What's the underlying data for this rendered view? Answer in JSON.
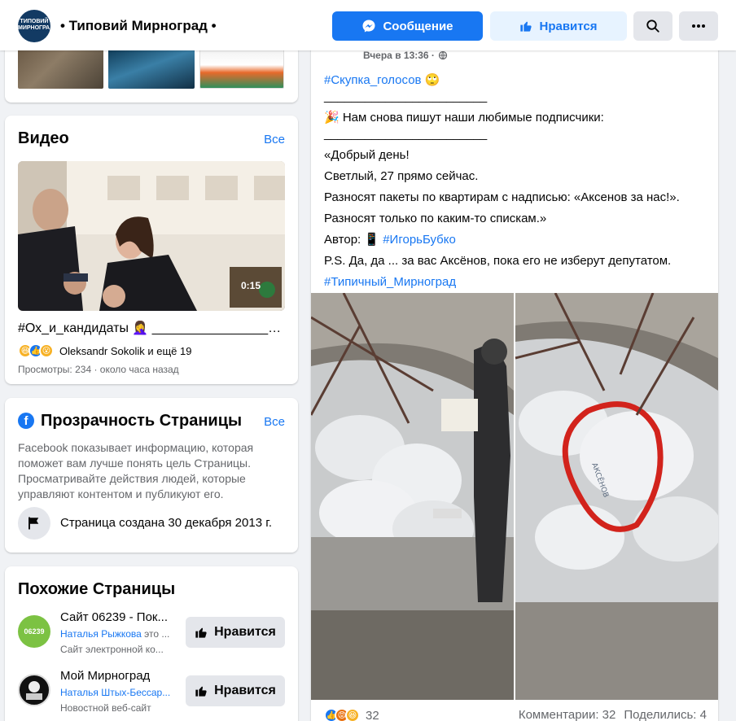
{
  "header": {
    "page_name": "• Типовий Мирноград •",
    "logo_text": "ТИПОВИЙ МИРНОГРАД",
    "message_label": "Сообщение",
    "like_label": "Нравится"
  },
  "video": {
    "title": "Видео",
    "see_all": "Все",
    "duration": "0:15",
    "caption": "#Ох_и_кандидаты 🤦‍♀️ ____________________...",
    "reactions_text": "Oleksandr Sokolik и ещё 19",
    "views": "Просмотры: 234 · около часа назад"
  },
  "transparency": {
    "title": "Прозрачность Страницы",
    "see_all": "Все",
    "description": "Facebook показывает информацию, которая поможет вам лучше понять цель Страницы. Просматривайте действия людей, которые управляют контентом и публикуют его.",
    "created": "Страница создана 30 декабря 2013 г."
  },
  "similar": {
    "title": "Похожие Страницы",
    "items": [
      {
        "name": "Сайт 06239 - Пок...",
        "person": "Наталья Рыжкова",
        "person_suffix": " это ...",
        "category": "Сайт электронной ко...",
        "button": "Нравится",
        "avatar_text": "06239"
      },
      {
        "name": "Мой Мирноград",
        "person": "Наталья Штых-Бессар...",
        "person_suffix": "",
        "category": "Новостной веб-сайт",
        "button": "Нравится",
        "avatar_text": ""
      }
    ]
  },
  "post": {
    "time": "Вчера в 13:36 ·",
    "hashtag_top": "#Скупка_голосов 🙄",
    "rule1": "________________________",
    "intro": "🎉 Нам снова пишут наши любимые подписчики:",
    "rule2": "________________________",
    "lines": [
      "«Добрый день!",
      "Светлый, 27 прямо сейчас.",
      "Разносят пакеты по квартирам с надписью: «Аксенов за нас!».",
      "Разносят только по каким-то спискам.»"
    ],
    "author_prefix": "Автор: 📱 ",
    "author_tag": "#ИгорьБубко",
    "ps": "P.S. Да, да ... за вас Аксёнов, пока его не изберут депутатом.",
    "hashtag_bottom": "#Типичный_Мирноград",
    "reaction_count": "32",
    "comments": "Комментарии: 32",
    "shares": "Поделились: 4"
  },
  "colors": {
    "primary": "#1877f2",
    "primary_light": "#e7f3ff",
    "grey_button": "#e4e6eb",
    "secondary_text": "#65676b",
    "bg": "#f0f2f5"
  },
  "icons": {
    "messenger": "messenger-icon",
    "thumbs_up": "thumbs-up-icon",
    "search": "search-icon",
    "more": "more-icon",
    "flag": "flag-icon",
    "globe": "globe-icon"
  }
}
